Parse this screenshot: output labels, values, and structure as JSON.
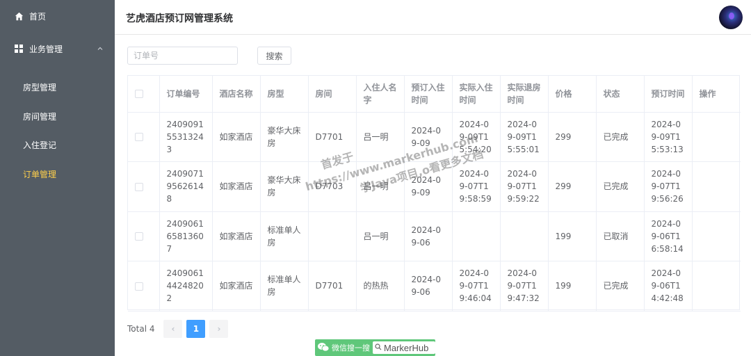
{
  "sidebar": {
    "home": {
      "label": "首页",
      "icon": "home-icon"
    },
    "business": {
      "label": "业务管理",
      "icon": "grid-icon",
      "expanded": true
    },
    "subitems": [
      {
        "label": "房型管理"
      },
      {
        "label": "房间管理"
      },
      {
        "label": "入住登记"
      },
      {
        "label": "订单管理",
        "active": true
      }
    ]
  },
  "header": {
    "title": "艺虎酒店预订网管理系统"
  },
  "search": {
    "placeholder": "订单号",
    "button_label": "搜索"
  },
  "table": {
    "columns": [
      "",
      "订单编号",
      "酒店名称",
      "房型",
      "房间",
      "入住人名字",
      "预订入住时间",
      "实际入住时间",
      "实际退房时间",
      "价格",
      "状态",
      "预订时间",
      "操作"
    ],
    "rows": [
      {
        "order_no": "240909155313243",
        "hotel": "如家酒店",
        "room_type": "豪华大床房",
        "room": "D7701",
        "guest": "吕一明",
        "booked_checkin": "2024-09-09",
        "actual_checkin": "2024-09-09T15:54:20",
        "actual_checkout": "2024-09-09T15:55:01",
        "price": "299",
        "status": "已完成",
        "booked_at": "2024-09-09T15:53:13",
        "action": ""
      },
      {
        "order_no": "240907195626148",
        "hotel": "如家酒店",
        "room_type": "豪华大床房",
        "room": "D7703",
        "guest": "吕一明",
        "booked_checkin": "2024-09-09",
        "actual_checkin": "2024-09-07T19:58:59",
        "actual_checkout": "2024-09-07T19:59:22",
        "price": "299",
        "status": "已完成",
        "booked_at": "2024-09-07T19:56:26",
        "action": ""
      },
      {
        "order_no": "240906165813607",
        "hotel": "如家酒店",
        "room_type": "标准单人房",
        "room": "",
        "guest": "吕一明",
        "booked_checkin": "2024-09-06",
        "actual_checkin": "",
        "actual_checkout": "",
        "price": "199",
        "status": "已取消",
        "booked_at": "2024-09-06T16:58:14",
        "action": ""
      },
      {
        "order_no": "240906144248202",
        "hotel": "如家酒店",
        "room_type": "标准单人房",
        "room": "D7701",
        "guest": "的热热",
        "booked_checkin": "2024-09-06",
        "actual_checkin": "2024-09-07T19:46:04",
        "actual_checkout": "2024-09-07T19:47:32",
        "price": "199",
        "status": "已完成",
        "booked_at": "2024-09-06T14:42:48",
        "action": ""
      }
    ]
  },
  "pagination": {
    "total_label": "Total 4",
    "prev": "‹",
    "current": "1",
    "next": "›"
  },
  "watermark": {
    "line1": "首发于",
    "line2": "https://www.markerhub.com",
    "line3": "学Java项目,o看更多文档"
  },
  "wechat_badge": {
    "text": "微信搜一搜",
    "brand": "MarkerHub"
  }
}
